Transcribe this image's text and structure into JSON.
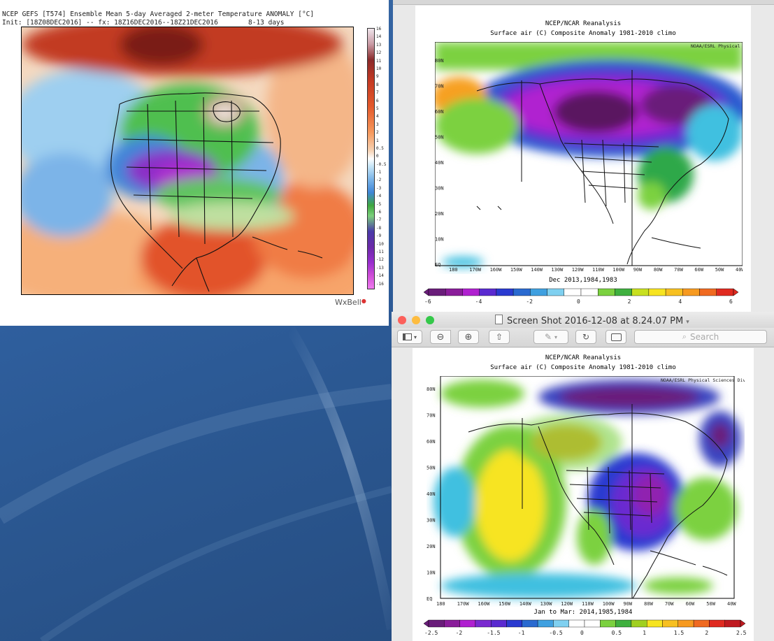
{
  "left_window": {
    "title_line1": "NCEP GEFS [T574] Ensemble Mean 5-day Averaged 2-meter Temperature ANOMALY [°C]",
    "title_line2": "Init: [18Z08DEC2016] -- fx: 18Z16DEC2016--18Z21DEC2016",
    "title_line2_right": "8-13 days",
    "colorbar_labels": [
      "16",
      "14",
      "13",
      "12",
      "11",
      "10",
      "9",
      "8",
      "7",
      "6",
      "5",
      "4",
      "3",
      "2",
      "1",
      "0.5",
      "0",
      "-0.5",
      "-1",
      "-2",
      "-3",
      "-4",
      "-5",
      "-6",
      "-7",
      "-8",
      "-9",
      "-10",
      "-11",
      "-12",
      "-13",
      "-14",
      "-16"
    ],
    "brand": "WxBell"
  },
  "top_right": {
    "title": "NCEP/NCAR Reanalysis",
    "subtitle": "Surface air (C) Composite Anomaly 1981-2010 climo",
    "credit": "NOAA/ESRL Physical Sciences Division",
    "y_labels": [
      "80N",
      "70N",
      "60N",
      "50N",
      "40N",
      "30N",
      "20N",
      "10N",
      "EQ"
    ],
    "x_labels": [
      "180",
      "170W",
      "160W",
      "150W",
      "140W",
      "130W",
      "120W",
      "110W",
      "100W",
      "90W",
      "80W",
      "70W",
      "60W",
      "50W",
      "40W"
    ],
    "caption": "Dec 2013,1984,1983",
    "scale_labels": [
      "-6",
      "-4",
      "-2",
      "0",
      "2",
      "4",
      "6"
    ]
  },
  "preview_window": {
    "title": "Screen Shot 2016-12-08 at 8.24.07 PM",
    "search_placeholder": "Search",
    "map": {
      "title": "NCEP/NCAR Reanalysis",
      "subtitle": "Surface air (C) Composite Anomaly 1981-2010 climo",
      "credit": "NOAA/ESRL Physical Sciences Division",
      "y_labels": [
        "80N",
        "70N",
        "60N",
        "50N",
        "40N",
        "30N",
        "20N",
        "10N",
        "EQ"
      ],
      "x_labels": [
        "180",
        "170W",
        "160W",
        "150W",
        "140W",
        "130W",
        "120W",
        "110W",
        "100W",
        "90W",
        "80W",
        "70W",
        "60W",
        "50W",
        "40W"
      ],
      "caption": "Jan to Mar: 2014,1985,1984",
      "scale_labels": [
        "-2.5",
        "-2",
        "-1.5",
        "-1",
        "-0.5",
        "0",
        "0.5",
        "1",
        "1.5",
        "2",
        "2.5"
      ]
    }
  },
  "colors": {
    "desktop_blue": "#2f5f9e",
    "close": "#fc605b",
    "minimize": "#fdbc40",
    "zoom": "#34c84a"
  }
}
